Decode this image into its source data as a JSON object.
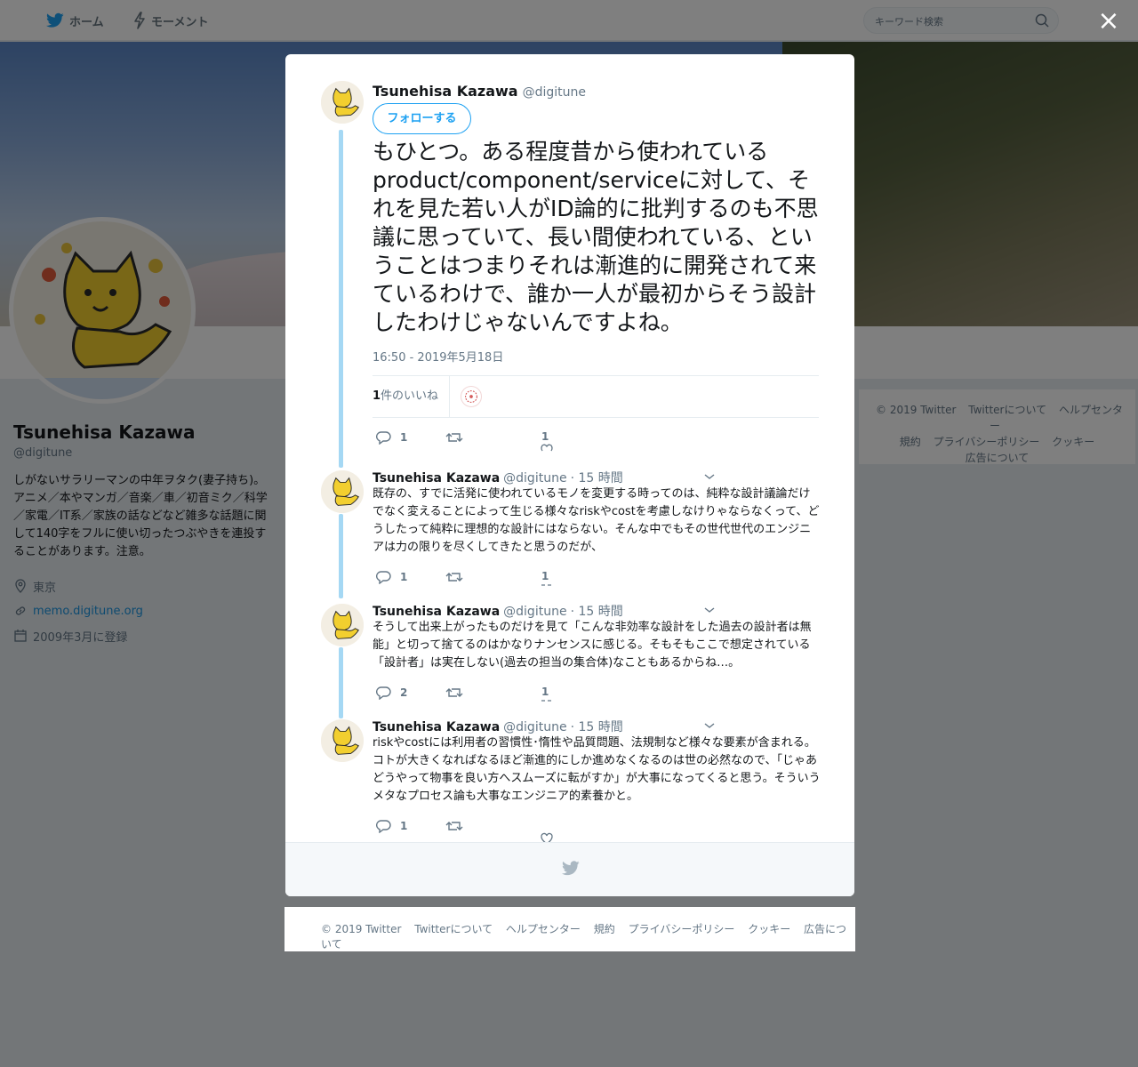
{
  "nav": {
    "home_label": "ホーム",
    "moments_label": "モーメント",
    "search_placeholder": "キーワード検索"
  },
  "profile": {
    "name": "Tsunehisa Kazawa",
    "handle": "@digitune",
    "bio": "しがないサラリーマンの中年ヲタク(妻子持ち)。アニメ／本やマンガ／音楽／車／初音ミク／科学／家電／IT系／家族の話などなど雑多な話題に関して140字をフルに使い切ったつぶやきを連投することがあります。注意。",
    "location": "東京",
    "url": "memo.digitune.org",
    "joined": "2009年3月に登録"
  },
  "side_footer": {
    "items": [
      "© 2019 Twitter",
      "Twitterについて",
      "ヘルプセンター",
      "規約",
      "プライバシーポリシー",
      "クッキー",
      "広告について"
    ]
  },
  "modal": {
    "close_label": "×",
    "main_tweet": {
      "name": "Tsunehisa Kazawa",
      "handle": "@digitune",
      "follow_label": "フォローする",
      "text": "もひとつ。ある程度昔から使われているproduct/component/serviceに対して、それを見た若い人がID論的に批判するのも不思議に思っていて、長い間使われている、ということはつまりそれは漸進的に開発されて来ているわけで、誰か一人が最初からそう設計したわけじゃないんですよね。",
      "timestamp": "16:50 - 2019年5月18日",
      "likes_count": "1",
      "likes_label": "件のいいね",
      "reply_count": "1",
      "like_count": "1"
    },
    "replies": [
      {
        "name": "Tsunehisa Kazawa",
        "handle": "@digitune",
        "time": "· 15 時間",
        "text": "既存の、すでに活発に使われているモノを変更する時ってのは、純粋な設計議論だけでなく変えることによって生じる様々なriskやcostを考慮しなけりゃならなくって、どうしたって純粋に理想的な設計にはならない。そんな中でもその世代世代のエンジニアは力の限りを尽くしてきたと思うのだが、",
        "reply_count": "1",
        "like_count": "1"
      },
      {
        "name": "Tsunehisa Kazawa",
        "handle": "@digitune",
        "time": "· 15 時間",
        "text": "そうして出来上がったものだけを見て「こんな非効率な設計をした過去の設計者は無能」と切って捨てるのはかなりナンセンスに感じる。そもそもここで想定されている「設計者」は実在しない(過去の担当の集合体)なこともあるからね…。",
        "reply_count": "2",
        "like_count": "1"
      },
      {
        "name": "Tsunehisa Kazawa",
        "handle": "@digitune",
        "time": "· 15 時間",
        "text": "riskやcostには利用者の習慣性･惰性や品質問題、法規制など様々な要素が含まれる。コトが大きくなればなるほど漸進的にしか進めなくなるのは世の必然なので、「じゃあどうやって物事を良い方へスムーズに転がすか」が大事になってくると思う。そういうメタなプロセス論も大事なエンジニア的素養かと。",
        "reply_count": "1",
        "like_count": ""
      }
    ]
  },
  "bottom_footer": {
    "items": [
      "© 2019 Twitter",
      "Twitterについて",
      "ヘルプセンター",
      "規約",
      "プライバシーポリシー",
      "クッキー",
      "広告について"
    ]
  },
  "colors": {
    "accent": "#1da1f2",
    "thread_line": "#a5d8f4",
    "overlay": "rgba(0,0,0,0.5)"
  },
  "icons": [
    "twitter-bird-icon",
    "lightning-icon",
    "search-icon",
    "close-icon",
    "reply-icon",
    "retweet-icon",
    "heart-icon",
    "chevron-down-icon",
    "location-icon",
    "link-icon",
    "calendar-icon"
  ]
}
